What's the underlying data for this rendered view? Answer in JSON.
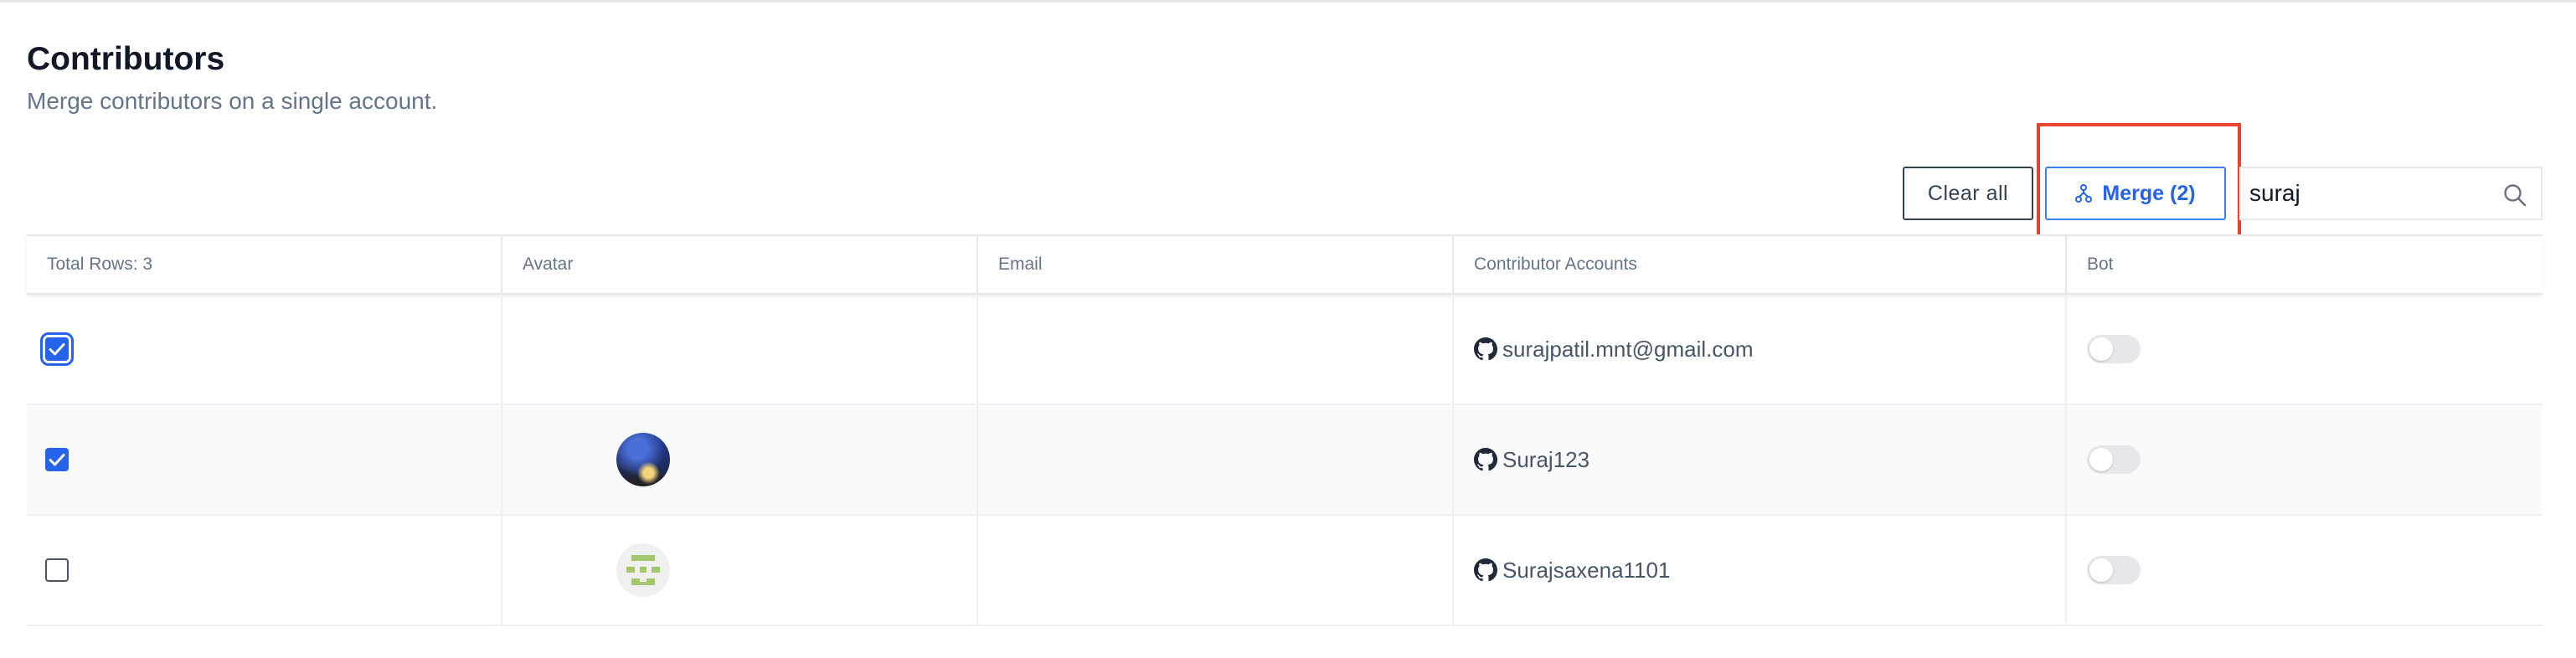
{
  "header": {
    "title": "Contributors",
    "subtitle": "Merge contributors on a single account."
  },
  "toolbar": {
    "clear_label": "Clear all",
    "merge_label": "Merge (2)",
    "search_value": "suraj"
  },
  "table": {
    "columns": [
      "Total Rows: 3",
      "Avatar",
      "Email",
      "Contributor Accounts",
      "Bot"
    ],
    "rows": [
      {
        "selected": true,
        "avatar": "none",
        "email": "",
        "account": "surajpatil.mnt@gmail.com",
        "bot": false
      },
      {
        "selected": true,
        "avatar": "photo",
        "email": "",
        "account": "Suraj123",
        "bot": false
      },
      {
        "selected": false,
        "avatar": "identicon",
        "email": "",
        "account": "Surajsaxena1101",
        "bot": false
      }
    ]
  },
  "icons": {
    "merge": "merge-icon",
    "search": "search-icon",
    "account": "github-icon"
  },
  "colors": {
    "accent": "#2563eb",
    "highlight": "#e8452f",
    "identicon": "#a3c76a"
  }
}
